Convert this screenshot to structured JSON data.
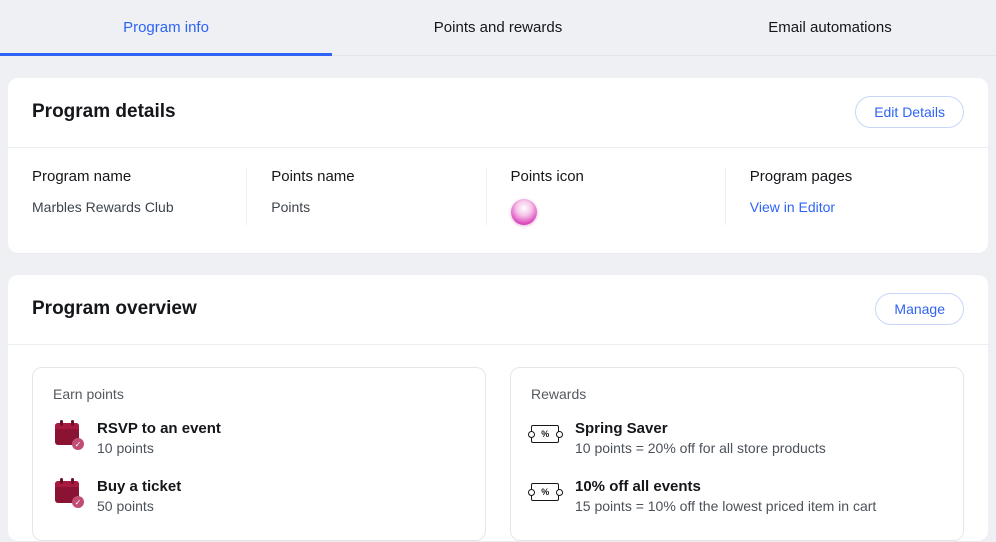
{
  "tabs": {
    "program_info": "Program info",
    "points_rewards": "Points and rewards",
    "email_automations": "Email automations"
  },
  "program_details": {
    "heading": "Program details",
    "edit_button": "Edit Details",
    "columns": {
      "program_name": {
        "label": "Program name",
        "value": "Marbles Rewards Club"
      },
      "points_name": {
        "label": "Points name",
        "value": "Points"
      },
      "points_icon": {
        "label": "Points icon"
      },
      "program_pages": {
        "label": "Program pages",
        "link": "View in Editor"
      }
    }
  },
  "program_overview": {
    "heading": "Program overview",
    "manage_button": "Manage",
    "earn": {
      "heading": "Earn points",
      "items": [
        {
          "title": "RSVP to an event",
          "sub": "10 points"
        },
        {
          "title": "Buy a ticket",
          "sub": "50 points"
        }
      ]
    },
    "rewards": {
      "heading": "Rewards",
      "items": [
        {
          "title": "Spring Saver",
          "sub": "10 points = 20% off for all store products"
        },
        {
          "title": "10% off all events",
          "sub": "15 points = 10% off the lowest priced item in cart"
        }
      ]
    }
  }
}
